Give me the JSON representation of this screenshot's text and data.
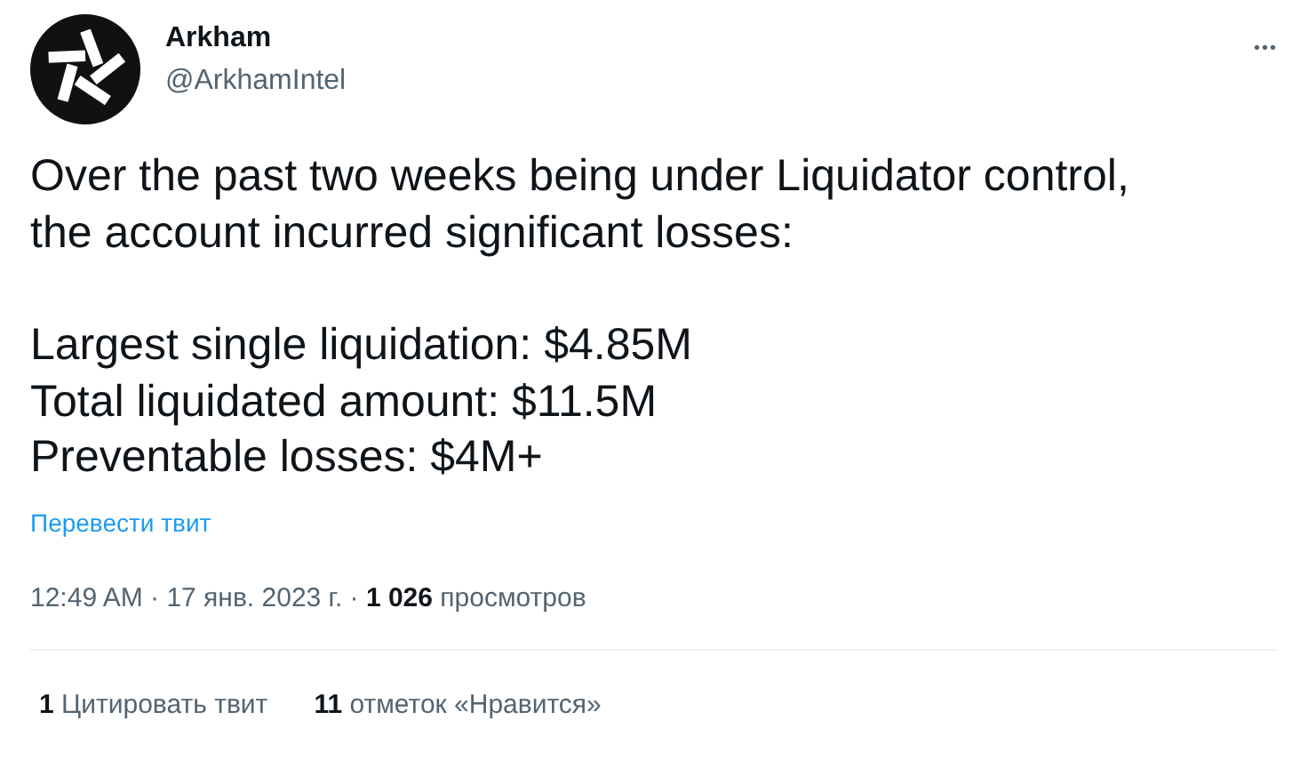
{
  "author": {
    "name": "Arkham",
    "handle": "@ArkhamIntel"
  },
  "more_button": "•••",
  "tweet_text": [
    "Over the past two weeks being under Liquidator control, the account incurred significant losses:",
    "Largest single liquidation: $4.85M",
    "Total liquidated amount: $11.5M",
    "Preventable losses: $4M+"
  ],
  "translate_link": "Перевести твит",
  "meta": "12:49 AM · 17 янв. 2023 г. · **1 026** просмотров",
  "stats": [
    "**1** Цитировать твит",
    "**11** отметок «Нравится»"
  ]
}
